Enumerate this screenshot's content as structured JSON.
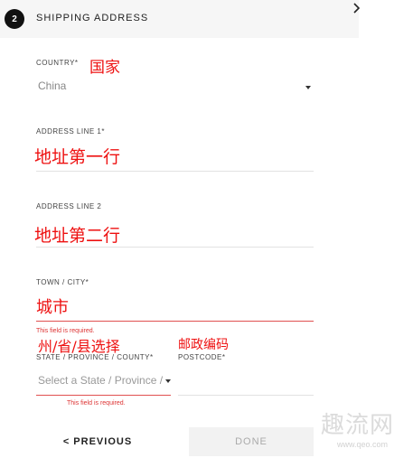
{
  "header": {
    "step_number": "2",
    "title": "SHIPPING ADDRESS"
  },
  "fields": {
    "country": {
      "label": "COUNTRY*",
      "annotation": "国家",
      "value": "China"
    },
    "address_line_1": {
      "label": "ADDRESS LINE 1*",
      "annotation": "地址第一行"
    },
    "address_line_2": {
      "label": "ADDRESS LINE 2",
      "annotation": "地址第二行"
    },
    "town_city": {
      "label": "TOWN / CITY*",
      "annotation": "城市",
      "error": "This field is required."
    },
    "state": {
      "label": "STATE / PROVINCE / COUNTY*",
      "annotation": "州/省/县选择",
      "placeholder": "Select a State / Province / County",
      "error": "This field is required."
    },
    "postcode": {
      "label": "POSTCODE*",
      "annotation": "邮政编码"
    }
  },
  "buttons": {
    "previous": "< PREVIOUS",
    "done": "DONE"
  },
  "watermark": {
    "text": "趣流网",
    "url": "www.qeo.com"
  },
  "colors": {
    "annotation": "#ee1111",
    "error": "#dd3333",
    "step_badge": "#111111"
  }
}
